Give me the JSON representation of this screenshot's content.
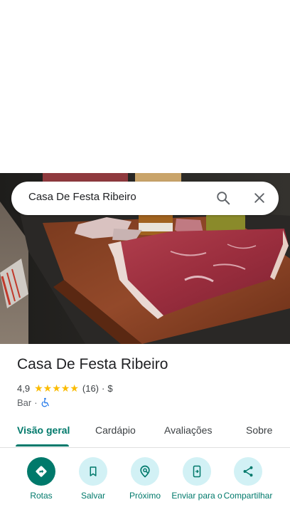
{
  "search": {
    "query": "Casa De Festa Ribeiro"
  },
  "place": {
    "name": "Casa De Festa Ribeiro",
    "rating": "4,9",
    "rating_value": 4.9,
    "stars_filled": 5,
    "reviews": "(16)",
    "separator": "·",
    "price": "$",
    "category": "Bar",
    "accessibility_icon": "wheelchair-icon"
  },
  "tabs": [
    {
      "label": "Visão geral",
      "active": true
    },
    {
      "label": "Cardápio",
      "active": false
    },
    {
      "label": "Avaliações",
      "active": false
    },
    {
      "label": "Sobre",
      "active": false
    }
  ],
  "actions": [
    {
      "label": "Rotas",
      "icon": "directions-icon"
    },
    {
      "label": "Salvar",
      "icon": "bookmark-icon"
    },
    {
      "label": "Próximo",
      "icon": "nearby-icon"
    },
    {
      "label": "Enviar para o",
      "icon": "send-to-phone-icon"
    },
    {
      "label": "Compartilhar",
      "icon": "share-icon"
    }
  ],
  "colors": {
    "accent": "#00796b",
    "action_bg": "#d2f1f5",
    "star": "#fbbc04"
  }
}
